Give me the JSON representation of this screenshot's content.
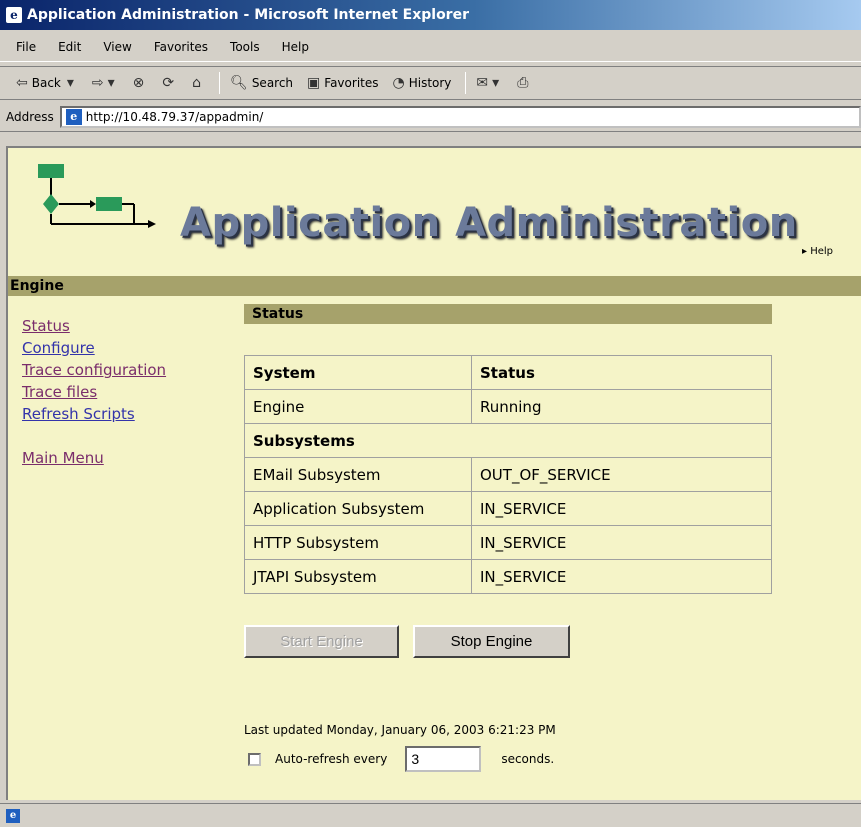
{
  "window": {
    "title": "Application Administration - Microsoft Internet Explorer"
  },
  "menu": [
    "File",
    "Edit",
    "View",
    "Favorites",
    "Tools",
    "Help"
  ],
  "toolbar": {
    "back": "Back",
    "search": "Search",
    "favorites": "Favorites",
    "history": "History"
  },
  "address": {
    "label": "Address",
    "url": "http://10.48.79.37/appadmin/"
  },
  "page": {
    "title": "Application Administration",
    "help": "Help",
    "section": "Engine"
  },
  "nav": {
    "status": "Status",
    "configure": "Configure",
    "trace_config": "Trace configuration",
    "trace_files": "Trace files",
    "refresh_scripts": "Refresh Scripts",
    "main_menu": "Main Menu"
  },
  "status_panel": {
    "header": "Status",
    "col_system": "System",
    "col_status": "Status",
    "engine_label": "Engine",
    "engine_status": "Running",
    "subsystems_label": "Subsystems",
    "rows": [
      {
        "name": "EMail Subsystem",
        "status": "OUT_OF_SERVICE"
      },
      {
        "name": "Application Subsystem",
        "status": "IN_SERVICE"
      },
      {
        "name": "HTTP Subsystem",
        "status": "IN_SERVICE"
      },
      {
        "name": "JTAPI Subsystem",
        "status": "IN_SERVICE"
      }
    ]
  },
  "buttons": {
    "start": "Start Engine",
    "stop": "Stop Engine"
  },
  "footer": {
    "last_updated": "Last updated Monday, January 06, 2003 6:21:23 PM",
    "auto_refresh_label": "Auto-refresh every",
    "interval": "3",
    "seconds": "seconds."
  }
}
